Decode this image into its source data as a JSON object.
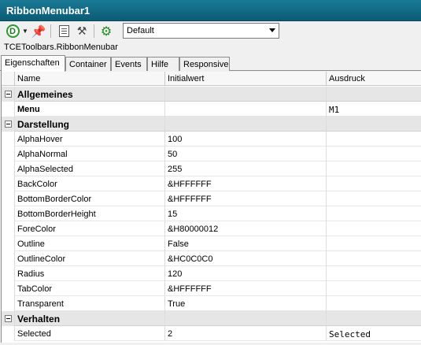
{
  "window": {
    "title": "RibbonMenubar1"
  },
  "toolbar": {
    "d_label": "D",
    "pin_glyph": "📌",
    "hammer_glyph": "⚒",
    "gear_glyph": "⚙",
    "dropdown_value": "Default",
    "icons": [
      "d-circle-icon",
      "chevron-down-icon",
      "pin-icon",
      "properties-sheet-icon",
      "hammer-icon",
      "gear-icon"
    ]
  },
  "class_name": "TCEToolbars.RibbonMenubar",
  "tabs": [
    {
      "label": "Eigenschaften",
      "active": true
    },
    {
      "label": "Container"
    },
    {
      "label": "Events"
    },
    {
      "label": "Hilfe"
    },
    {
      "label": "Responsive"
    }
  ],
  "grid": {
    "columns": [
      "Name",
      "Initialwert",
      "Ausdruck"
    ],
    "rows": [
      {
        "type": "category",
        "name": "Allgemeines"
      },
      {
        "type": "prop",
        "name": "Menu",
        "bold": true,
        "initial": "",
        "expression": "M1"
      },
      {
        "type": "category",
        "name": "Darstellung"
      },
      {
        "type": "prop",
        "name": "AlphaHover",
        "initial": "100",
        "expression": ""
      },
      {
        "type": "prop",
        "name": "AlphaNormal",
        "initial": "50",
        "expression": ""
      },
      {
        "type": "prop",
        "name": "AlphaSelected",
        "initial": "255",
        "expression": ""
      },
      {
        "type": "prop",
        "name": "BackColor",
        "initial": "&HFFFFFF",
        "expression": ""
      },
      {
        "type": "prop",
        "name": "BottomBorderColor",
        "initial": "&HFFFFFF",
        "expression": ""
      },
      {
        "type": "prop",
        "name": "BottomBorderHeight",
        "initial": "15",
        "expression": ""
      },
      {
        "type": "prop",
        "name": "ForeColor",
        "initial": "&H80000012",
        "expression": ""
      },
      {
        "type": "prop",
        "name": "Outline",
        "initial": "False",
        "expression": ""
      },
      {
        "type": "prop",
        "name": "OutlineColor",
        "initial": "&HC0C0C0",
        "expression": ""
      },
      {
        "type": "prop",
        "name": "Radius",
        "initial": "120",
        "expression": ""
      },
      {
        "type": "prop",
        "name": "TabColor",
        "initial": "&HFFFFFF",
        "expression": ""
      },
      {
        "type": "prop",
        "name": "Transparent",
        "initial": "True",
        "expression": ""
      },
      {
        "type": "category",
        "name": "Verhalten"
      },
      {
        "type": "prop",
        "name": "Selected",
        "initial": "2",
        "expression": "Selected"
      }
    ]
  },
  "colors": {
    "titlebar": "#0b5b74",
    "category_row": "#e6e6e6",
    "gear": "#1f8a1f"
  }
}
